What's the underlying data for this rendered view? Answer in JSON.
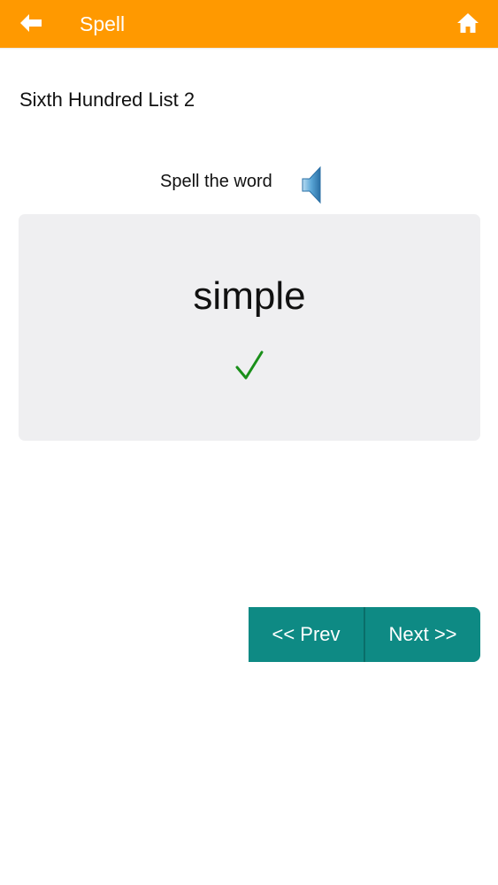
{
  "header": {
    "title": "Spell",
    "back_icon": "back-arrow-icon",
    "home_icon": "home-icon",
    "background_color": "#ff9900"
  },
  "list_title": "Sixth Hundred List 2",
  "prompt": {
    "text": "Spell the word",
    "speaker_icon": "speaker-icon"
  },
  "card": {
    "word": "simple",
    "status_icon": "checkmark-icon",
    "status_color": "#1a8f1a"
  },
  "navigation": {
    "prev_label": "<< Prev",
    "next_label": "Next >>",
    "button_color": "#0e8a84"
  }
}
